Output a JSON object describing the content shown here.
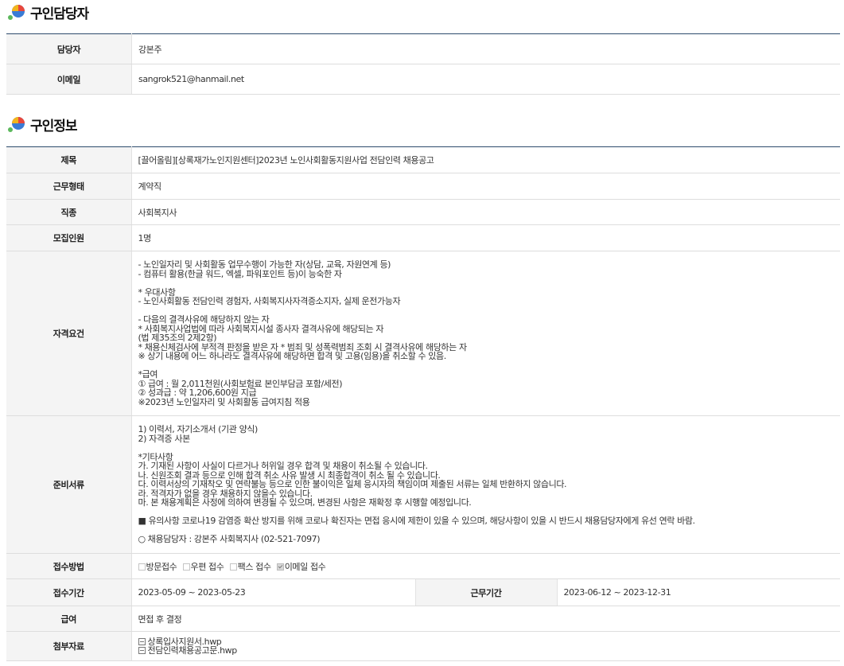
{
  "recruiter_section": {
    "title": "구인담당자",
    "rows": [
      {
        "label": "담당자",
        "value": "강본주"
      },
      {
        "label": "이메일",
        "value": "sangrok521@hanmail.net"
      }
    ]
  },
  "job_section": {
    "title": "구인정보",
    "title_row": {
      "label": "제목",
      "value": "[끌어올림][상록재가노인지원센터]2023년 노인사회활동지원사업 전담인력 채용공고"
    },
    "employment_type": {
      "label": "근무형태",
      "value": "계약직"
    },
    "occupation": {
      "label": "직종",
      "value": "사회복지사"
    },
    "headcount": {
      "label": "모집인원",
      "value": "1명"
    },
    "qualifications": {
      "label": "자격요건",
      "text": "- 노인일자리 및 사회활동 업무수행이 가능한 자(상담, 교육, 자원연계 등)\n- 컴퓨터 활용(한글 워드, 엑셀, 파워포인트 등)이 능숙한 자\n\n* 우대사항\n- 노인사회활동 전담인력 경험자, 사회복지사자격증소지자, 실제 운전가능자\n\n- 다음의 결격사유에 해당하지 않는 자\n* 사회복지사업법에 따라 사회복지시설 종사자 결격사유에 해당되는 자\n  (법 제35조의 2제2항)\n* 채용신체검사에 부적격 판정을 받은 자 * 범죄 및 성폭력범죄 조회 시 결격사유에 해당하는 자\n※ 상기 내용에 어느 하나라도 결격사유에 해당하면 합격 및 고용(임용)을 취소할 수 있음.\n\n*급여\n① 급여 : 월 2,011천원(사회보험료 본인부담금 포함/세전)\n② 성과급 : 약 1,206,600원 지급\n        ※2023년 노인일자리 및 사회활동 급여지침 적용"
    },
    "documents": {
      "label": "준비서류",
      "text": "1) 이력서, 자기소개서 (기관 양식)\n2) 자격증 사본\n\n*기타사항\n  가. 기재된 사항이 사실이 다르거나 허위일 경우 합격 및 채용이 취소될 수 있습니다.\n  나. 신원조회 결과 등으로 인해 합격 취소 사유 발생 시 최종합격이 취소 될 수 있습니다.\n  다. 이력서상의 기재착오 및 연락불능 등으로 인한 불이익은 일체 응시자의 책임이며 제출된 서류는 일체 반환하지 않습니다.\n  라. 적격자가 없을 경우 채용하지 않을수 있습니다.\n  마. 본 채용계획은 사정에 의하여 변경될 수 있으며, 변경된 사항은 재확정 후 시행할 예정입니다.\n\n■ 유의사항 코로나19 감염증 확산 방지를 위해 코로나 확진자는 면접 응시에 제한이 있을 수 있으며, 해당사항이 있을 시 반드시 채용담당자에게 유선 연락 바람.\n\n○ 채용담당자 : 강본주 사회복지사 (02-521-7097)"
    },
    "application_method": {
      "label": "접수방법",
      "options": [
        {
          "label": "방문접수",
          "checked": false
        },
        {
          "label": "우편 접수",
          "checked": false
        },
        {
          "label": "팩스 접수",
          "checked": false
        },
        {
          "label": "이메일 접수",
          "checked": true
        }
      ]
    },
    "application_period": {
      "label": "접수기간",
      "value": "2023-05-09 ~ 2023-05-23"
    },
    "work_period": {
      "label": "근무기간",
      "value": "2023-06-12 ~ 2023-12-31"
    },
    "salary": {
      "label": "급여",
      "value": "면접 후 결정"
    },
    "attachments": {
      "label": "첨부자료",
      "files": [
        "상록입사지원서.hwp",
        "전담인력채용공고문.hwp"
      ]
    }
  },
  "colors": {
    "table_top_border": "#2d4b6c",
    "header_cell_bg": "#f4f4f4",
    "row_divider": "#dddddd"
  }
}
